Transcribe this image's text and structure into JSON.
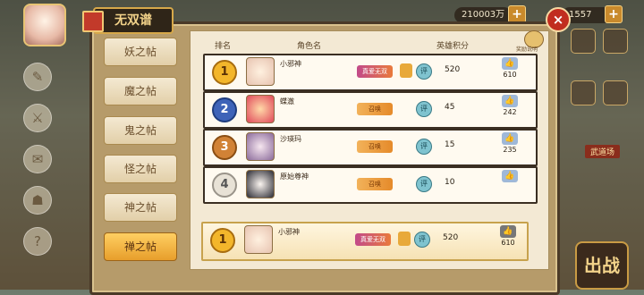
{
  "panel": {
    "title": "无双谱",
    "close_label": "×"
  },
  "top": {
    "currency_1": "210003万",
    "currency_2": "1557",
    "plus": "+"
  },
  "tabs": [
    "妖之帖",
    "魔之帖",
    "鬼之帖",
    "怪之帖",
    "神之帖",
    "禅之帖"
  ],
  "active_tab": 5,
  "columns": {
    "rank": "排名",
    "name": "角色名",
    "score": "英雄积分"
  },
  "trophy_label": "奖励说明",
  "rows": [
    {
      "rank": "1",
      "name": "小邪神",
      "badge": "真爱无双",
      "score_icon": "评",
      "score": "520",
      "likes": "610"
    },
    {
      "rank": "2",
      "name": "蝶澈",
      "badge": "召唤",
      "score_icon": "评",
      "score": "45",
      "likes": "242"
    },
    {
      "rank": "3",
      "name": "沙瑛玛",
      "badge": "召唤",
      "score_icon": "评",
      "score": "15",
      "likes": "235"
    },
    {
      "rank": "4",
      "name": "原始尊神",
      "badge": "召唤",
      "score_icon": "评",
      "score": "10",
      "likes": ""
    }
  ],
  "mine": {
    "rank": "1",
    "name": "小邪神",
    "badge": "真爱无双",
    "score_icon": "评",
    "score": "520",
    "likes": "610"
  },
  "battle_label": "出战",
  "wudao_label": "武道场"
}
